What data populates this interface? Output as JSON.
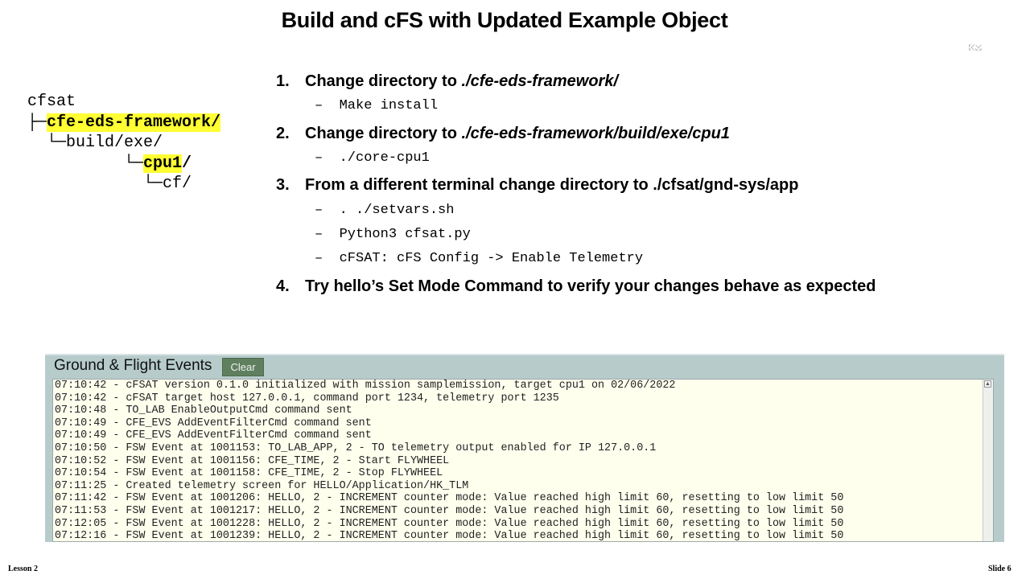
{
  "slide": {
    "title": "Build and cFS with Updated Example Object",
    "corner_mark": "⤪⤩",
    "footer_left": "Lesson 2",
    "footer_right": "Slide 6"
  },
  "tree": {
    "root": "cfsat",
    "l1_prefix": "├─",
    "l1_name": "cfe-eds-framework/",
    "l2": "  └─build/exe/",
    "l3_prefix": "          └─",
    "l3_name": "cpu1",
    "l3_suffix": "/",
    "l4": "            └─cf/"
  },
  "steps": [
    {
      "num": "1.",
      "text": "Change directory to ",
      "path": "./cfe-eds-framework/",
      "subs": [
        "–  Make install"
      ]
    },
    {
      "num": "2.",
      "text": "Change directory to ",
      "path": "./cfe-eds-framework/build/exe/cpu1",
      "subs": [
        "–  ./core-cpu1"
      ]
    },
    {
      "num": "3.",
      "text": "From a different terminal change directory to ./cfsat/gnd-sys/app",
      "path": "",
      "subs": [
        "–  . ./setvars.sh",
        "–  Python3 cfsat.py",
        "–  cFSAT: cFS Config -> Enable Telemetry"
      ]
    },
    {
      "num": "4.",
      "text": "Try hello’s Set Mode Command to verify your changes behave as expected",
      "path": "",
      "subs": []
    }
  ],
  "events_panel": {
    "title": "Ground & Flight Events",
    "clear_label": "Clear",
    "lines": [
      "07:10:42 - cFSAT version 0.1.0 initialized with mission samplemission, target cpu1 on 02/06/2022",
      "07:10:42 - cFSAT target host 127.0.0.1, command port 1234, telemetry port 1235",
      "07:10:48 - TO_LAB EnableOutputCmd command sent",
      "07:10:49 - CFE_EVS AddEventFilterCmd command sent",
      "07:10:49 - CFE_EVS AddEventFilterCmd command sent",
      "07:10:50 - FSW Event at 1001153: TO_LAB_APP, 2 - TO telemetry output enabled for IP 127.0.0.1",
      "07:10:52 - FSW Event at 1001156: CFE_TIME, 2 - Start FLYWHEEL",
      "07:10:54 - FSW Event at 1001158: CFE_TIME, 2 - Stop FLYWHEEL",
      "07:11:25 - Created telemetry screen for HELLO/Application/HK_TLM",
      "07:11:42 - FSW Event at 1001206: HELLO, 2 - INCREMENT counter mode: Value reached high limit 60, resetting to low limit 50",
      "07:11:53 - FSW Event at 1001217: HELLO, 2 - INCREMENT counter mode: Value reached high limit 60, resetting to low limit 50",
      "07:12:05 - FSW Event at 1001228: HELLO, 2 - INCREMENT counter mode: Value reached high limit 60, resetting to low limit 50",
      "07:12:16 - FSW Event at 1001239: HELLO, 2 - INCREMENT counter mode: Value reached high limit 60, resetting to low limit 50"
    ]
  }
}
